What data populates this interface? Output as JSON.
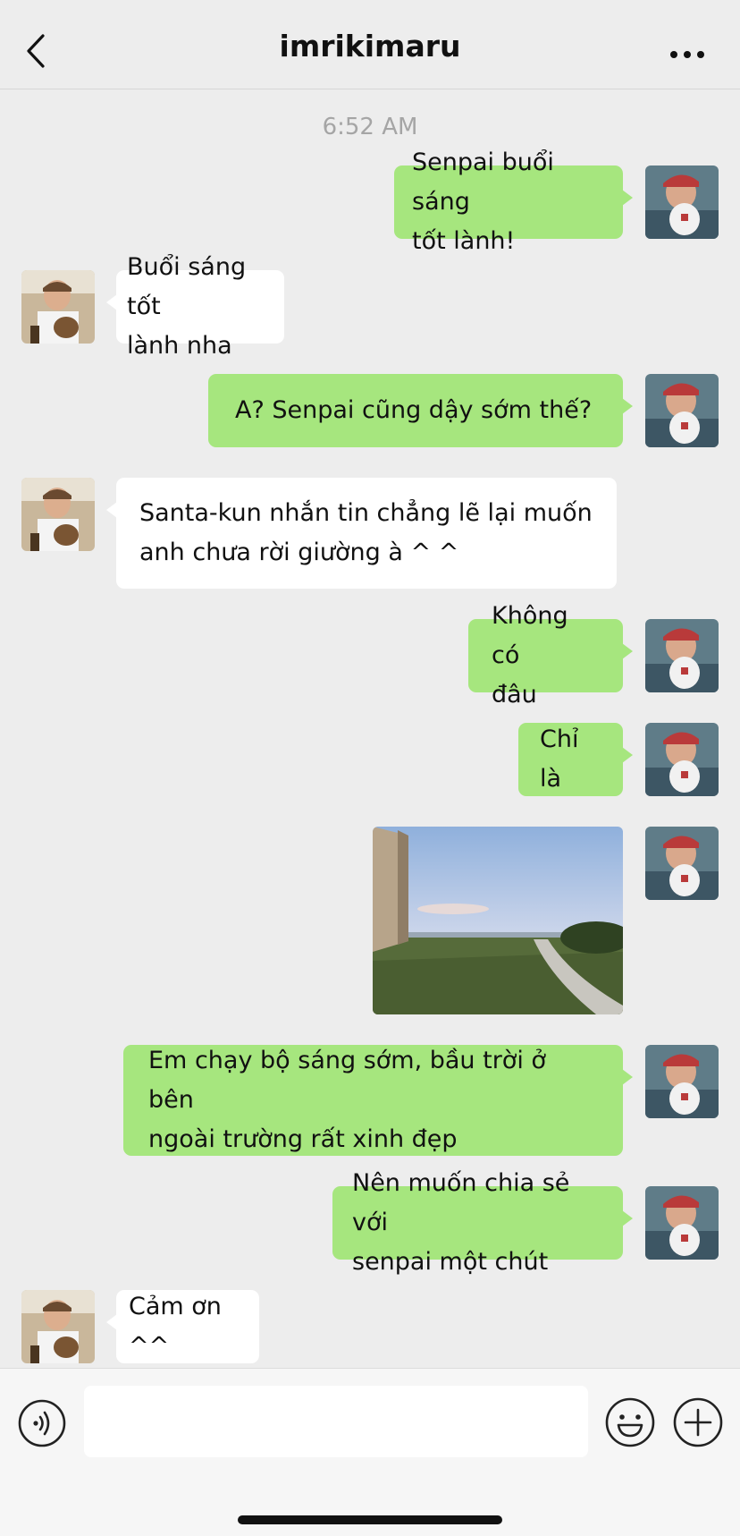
{
  "header": {
    "title": "imrikimaru",
    "back_icon": "chevron-left-icon",
    "more_icon": "ellipsis-icon"
  },
  "chat": {
    "timestamp": "6:52 AM",
    "messages": [
      {
        "from": "me",
        "type": "text",
        "lines": [
          "Senpai buổi sáng",
          "tốt lành!"
        ]
      },
      {
        "from": "them",
        "type": "text",
        "lines": [
          "Buổi sáng tốt",
          "lành nha"
        ]
      },
      {
        "from": "me",
        "type": "text",
        "lines": [
          "A? Senpai cũng dậy sớm thế?"
        ]
      },
      {
        "from": "them",
        "type": "text",
        "lines": [
          "Santa-kun nhắn tin chẳng lẽ lại muốn",
          "anh chưa rời giường à ^ ^"
        ]
      },
      {
        "from": "me",
        "type": "text",
        "lines": [
          "Không có",
          "đâu"
        ]
      },
      {
        "from": "me",
        "type": "text",
        "lines": [
          "Chỉ là"
        ]
      },
      {
        "from": "me",
        "type": "image",
        "description_icon": "photo-icon"
      },
      {
        "from": "me",
        "type": "text",
        "lines": [
          "Em chạy bộ sáng sớm, bầu trời ở bên",
          "ngoài trường rất xinh đẹp"
        ]
      },
      {
        "from": "me",
        "type": "text",
        "lines": [
          "Nên muốn chia sẻ với",
          "senpai một chút"
        ]
      },
      {
        "from": "them",
        "type": "text",
        "lines": [
          "Cảm ơn ^^"
        ]
      }
    ]
  },
  "inputbar": {
    "input_value": "",
    "voice_icon": "voice-icon",
    "emoji_icon": "emoji-icon",
    "plus_icon": "plus-icon"
  },
  "colors": {
    "background": "#ededed",
    "my_bubble": "#a6e67e",
    "their_bubble": "#ffffff",
    "timestamp": "#a5a5a5"
  }
}
